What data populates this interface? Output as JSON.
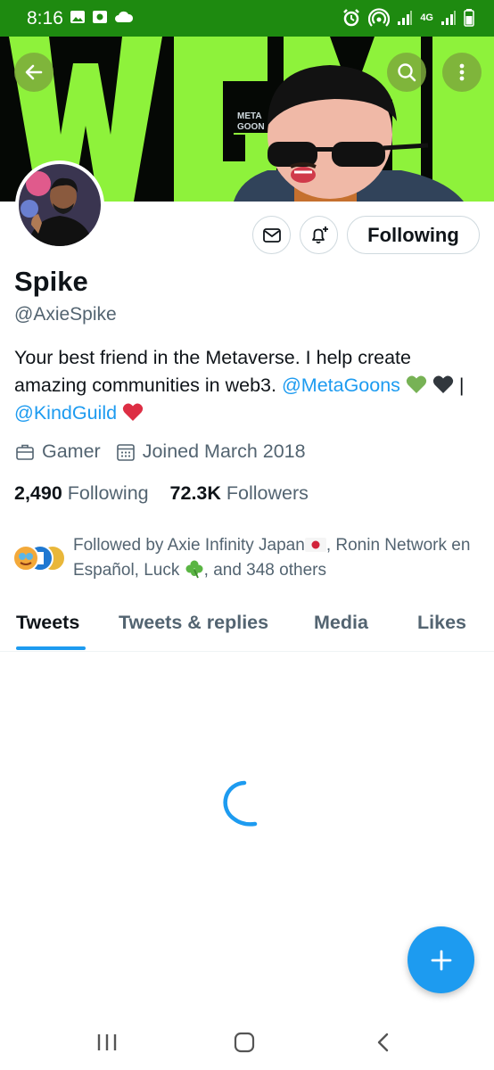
{
  "status_bar": {
    "time": "8:16",
    "left_icons": [
      "image-icon",
      "app-icon",
      "cloud-icon"
    ],
    "right_icons": [
      "alarm-icon",
      "hotspot-icon",
      "signal-icon",
      "network-4g-icon",
      "signal-icon",
      "battery-icon"
    ],
    "network_label": "4G"
  },
  "banner": {
    "text": "WGMI",
    "badge_text": "META GOONS",
    "accent": "#8ef23b"
  },
  "profile": {
    "name": "Spike",
    "handle": "@AxieSpike",
    "bio_text_1": "Your best friend in the Metaverse. I help create amazing communities in web3. ",
    "bio_mention_1": "@MetaGoons",
    "bio_separator": " | ",
    "bio_mention_2": "@KindGuild",
    "category": "Gamer",
    "joined": "Joined March 2018",
    "following_count": "2,490",
    "following_label": "Following",
    "followers_count": "72.3K",
    "followers_label": "Followers",
    "followed_by_text": "Followed by Axie Infinity Japan",
    "followed_by_rest_1": ", Ronin Network en Español, Luck ",
    "followed_by_rest_2": ", and 348 others"
  },
  "actions": {
    "following_button": "Following"
  },
  "tabs": [
    {
      "label": "Tweets",
      "active": true
    },
    {
      "label": "Tweets & replies",
      "active": false
    },
    {
      "label": "Media",
      "active": false
    },
    {
      "label": "Likes",
      "active": false
    }
  ],
  "colors": {
    "accent": "#1d9bf0",
    "status_bar": "#1e8a10",
    "secondary_text": "#536471"
  }
}
